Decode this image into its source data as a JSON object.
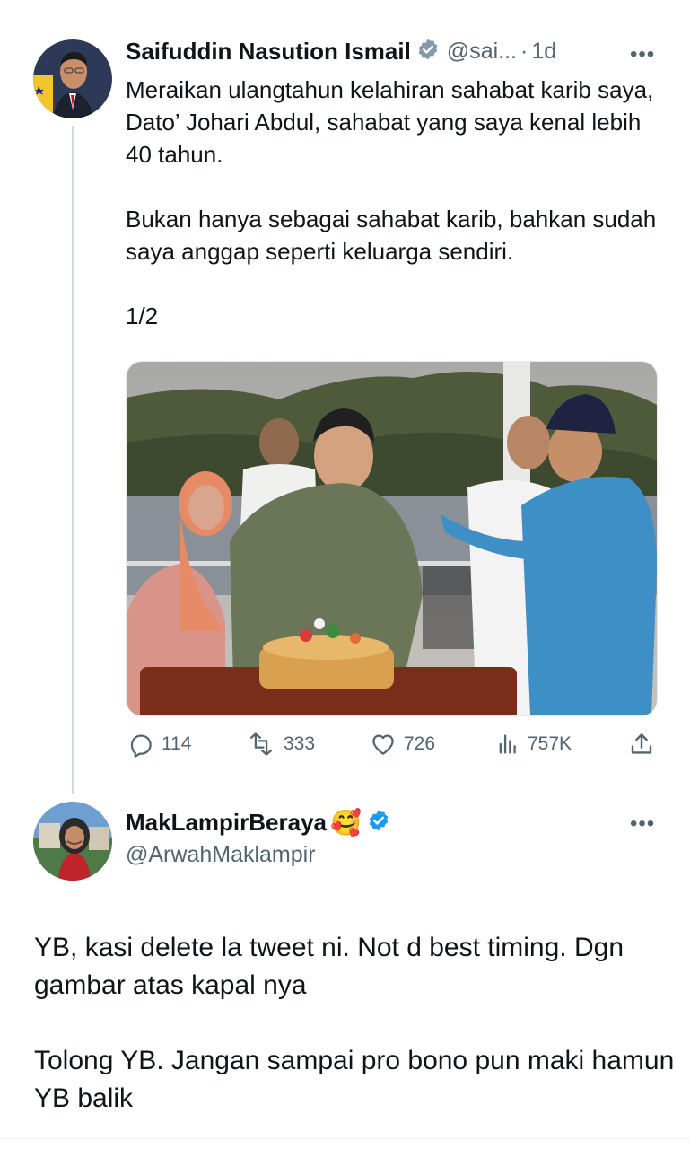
{
  "main_tweet": {
    "display_name": "Saifuddin Nasution Ismail",
    "handle": "@sai...",
    "separator": "·",
    "time": "1d",
    "more": "•••",
    "text": "Meraikan ulangtahun kelahiran sahabat karib saya, Dato’ Johari Abdul, sahabat yang saya kenal lebih 40 tahun.\n\nBukan hanya sebagai sahabat karib, bahkan sudah saya anggap seperti keluarga sendiri.\n\n1/2",
    "stats": {
      "replies": "114",
      "reposts": "333",
      "likes": "726",
      "views": "757K"
    }
  },
  "reply_tweet": {
    "display_name": "MakLampirBeraya",
    "emoji": "🥰",
    "handle": "@ArwahMaklampir",
    "more": "•••",
    "text": "YB, kasi delete la tweet ni. Not d best timing. Dgn gambar atas kapal nya\n\nTolong YB. Jangan sampai pro bono pun maki hamun YB balik"
  },
  "colors": {
    "verified_blue": "#1d9bf0",
    "verified_gray": "#829aab",
    "secondary_text": "#536471",
    "thread_line": "#cfd9de"
  },
  "icons": [
    "verified-gray-icon",
    "verified-blue-icon",
    "reply-icon",
    "repost-icon",
    "like-icon",
    "views-icon",
    "share-icon",
    "more-icon"
  ]
}
